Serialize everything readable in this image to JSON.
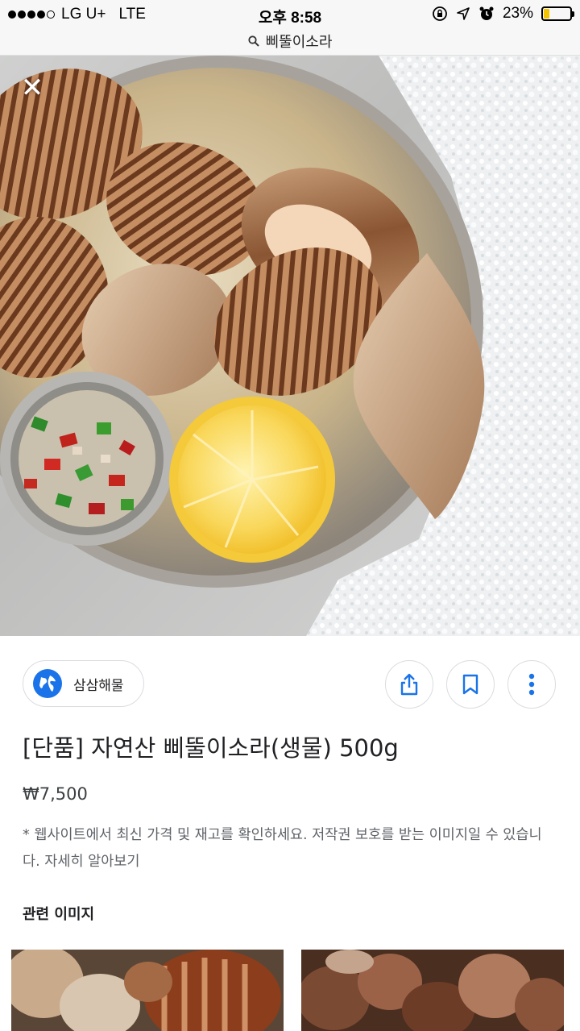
{
  "status_bar": {
    "carrier": "LG U+",
    "network": "LTE",
    "time": "오후 8:58",
    "battery": "23%",
    "battery_level": 0.23,
    "signal_bars_filled": 4,
    "signal_bars_total": 5
  },
  "url_bar": {
    "query": "삐뚤이소라"
  },
  "source": {
    "site_name": "삼삼해물"
  },
  "product": {
    "title": "[단품] 자연산 삐뚤이소라(생물) 500g",
    "price": "₩7,500"
  },
  "notice": {
    "text": "* 웹사이트에서 최신 가격 및 재고를 확인하세요. 저작권 보호를 받는 이미지일 수 있습니다.",
    "learn_more": "자세히 알아보기"
  },
  "related": {
    "title": "관련 이미지"
  },
  "colors": {
    "accent_blue": "#1a73e8",
    "battery_yellow": "#f4c400"
  },
  "icons": [
    "close-icon",
    "globe-icon",
    "share-icon",
    "bookmark-icon",
    "more-vert-icon",
    "search-icon"
  ]
}
